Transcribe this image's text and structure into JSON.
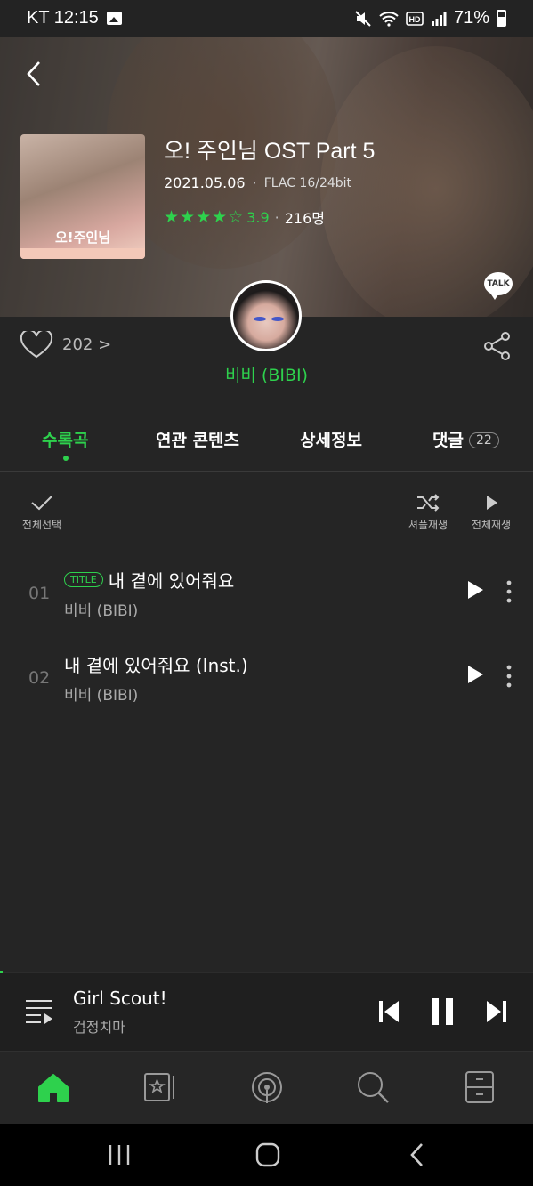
{
  "status_bar": {
    "carrier_time": "KT 12:15",
    "battery": "71%",
    "icons": [
      "gallery-icon",
      "mute-icon",
      "wifi-icon",
      "hd-icon",
      "signal-icon",
      "battery-icon"
    ]
  },
  "album": {
    "title": "오! 주인님 OST Part 5",
    "date": "2021.05.06",
    "format": "FLAC 16/24bit",
    "rating": "3.9",
    "rating_value": 3.9,
    "rating_count": "216명",
    "cover_title": "오!주인님",
    "talk_label": "TALK"
  },
  "social": {
    "likes": "202 >",
    "artist": "비비 (BIBI)"
  },
  "tabs": [
    {
      "label": "수록곡",
      "active": true
    },
    {
      "label": "연관 콘텐츠"
    },
    {
      "label": "상세정보"
    },
    {
      "label": "댓글",
      "badge": "22"
    }
  ],
  "actions": {
    "select_all": "전체선택",
    "shuffle": "셔플재생",
    "play_all": "전체재생"
  },
  "tracks": [
    {
      "num": "01",
      "tag": "TITLE",
      "title": "내 곁에 있어줘요",
      "artist": "비비 (BIBI)"
    },
    {
      "num": "02",
      "title": "내 곁에 있어줘요 (Inst.)",
      "artist": "비비 (BIBI)"
    }
  ],
  "now_playing": {
    "song": "Girl Scout!",
    "artist": "검정치마"
  },
  "bottom_nav": [
    "home-icon",
    "library-icon",
    "radio-icon",
    "search-icon",
    "drawer-icon"
  ],
  "colors": {
    "accent": "#2ed14d",
    "background": "#252525"
  }
}
